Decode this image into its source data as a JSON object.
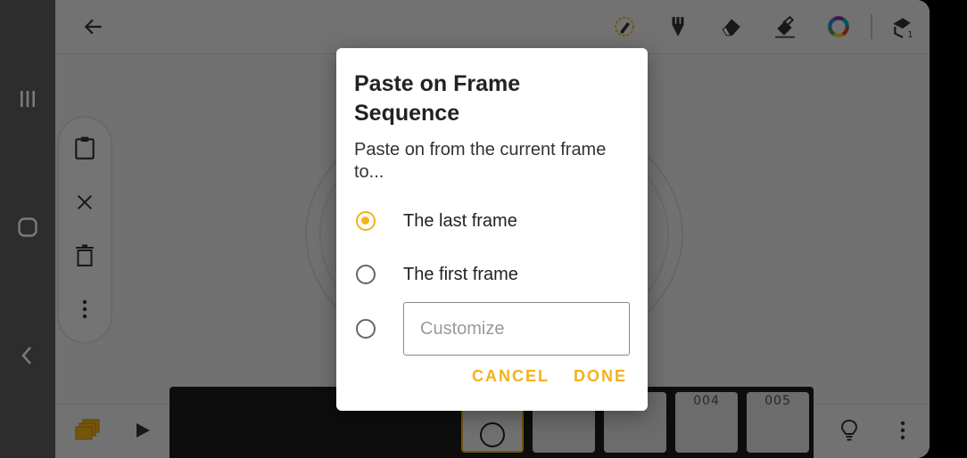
{
  "dialog": {
    "title": "Paste on Frame Sequence",
    "message": "Paste on from the current frame to...",
    "options": [
      {
        "label": "The last frame",
        "checked": true
      },
      {
        "label": "The first frame",
        "checked": false
      },
      {
        "label": "",
        "checked": false
      }
    ],
    "customize_placeholder": "Customize",
    "customize_value": "",
    "cancel_label": "CANCEL",
    "done_label": "DONE"
  },
  "timeline": {
    "frames": [
      {
        "label": ""
      },
      {
        "label": ""
      },
      {
        "label": ""
      },
      {
        "label": "004"
      },
      {
        "label": "005"
      }
    ]
  },
  "icons": {
    "top_bar": [
      "back-arrow-icon",
      "onion-skin-icon",
      "pen-icon",
      "eraser-icon",
      "fill-bucket-icon",
      "color-wheel-icon",
      "layer-selector-icon"
    ],
    "side_toolbar": [
      "clipboard-icon",
      "close-icon",
      "trash-icon",
      "more-vert-icon"
    ],
    "bottom_bar": [
      "layers-icon",
      "play-icon",
      "lightbulb-icon",
      "more-vert-icon"
    ],
    "nav_bar": [
      "recent-apps-icon",
      "home-icon",
      "back-icon"
    ]
  },
  "colors": {
    "accent": "#f3b21a",
    "dialog_bg": "#ffffff",
    "scrim": "rgba(0,0,0,0.52)",
    "frame_strip": "#1d1d1d"
  }
}
